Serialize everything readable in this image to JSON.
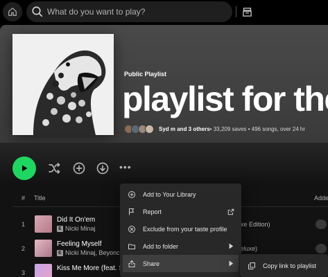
{
  "search": {
    "placeholder": "What do you want to play?"
  },
  "header": {
    "type": "Public Playlist",
    "title": "playlist for the",
    "owner": "Syd m and 3 others",
    "stats": " • 33,209 saves • 496 songs, over 24 hr"
  },
  "table": {
    "col_number": "#",
    "col_title": "Title",
    "col_added": "Adde"
  },
  "tracks": [
    {
      "number": "1",
      "title": "Did It On'em",
      "artist": "Nicki Minaj",
      "album": "luxe Edition)"
    },
    {
      "number": "2",
      "title": "Feeling Myself",
      "artist": "Nicki Minaj, Beyonce",
      "album": "Deluxe)"
    },
    {
      "number": "3",
      "title": "Kiss Me More (feat. S",
      "artist": "",
      "album": ""
    }
  ],
  "context_menu": {
    "items": [
      {
        "label": "Add to Your Library",
        "icon": "add-circle-icon"
      },
      {
        "label": "Report",
        "icon": "flag-icon"
      },
      {
        "label": "Exclude from your taste profile",
        "icon": "exclude-icon"
      },
      {
        "label": "Add to folder",
        "icon": "folder-icon"
      },
      {
        "label": "Share",
        "icon": "share-icon"
      }
    ]
  },
  "share_submenu": {
    "copy_link": "Copy link to playlist"
  },
  "colors": {
    "accent": "#1ed760",
    "background": "#121212",
    "menu": "#282828"
  }
}
